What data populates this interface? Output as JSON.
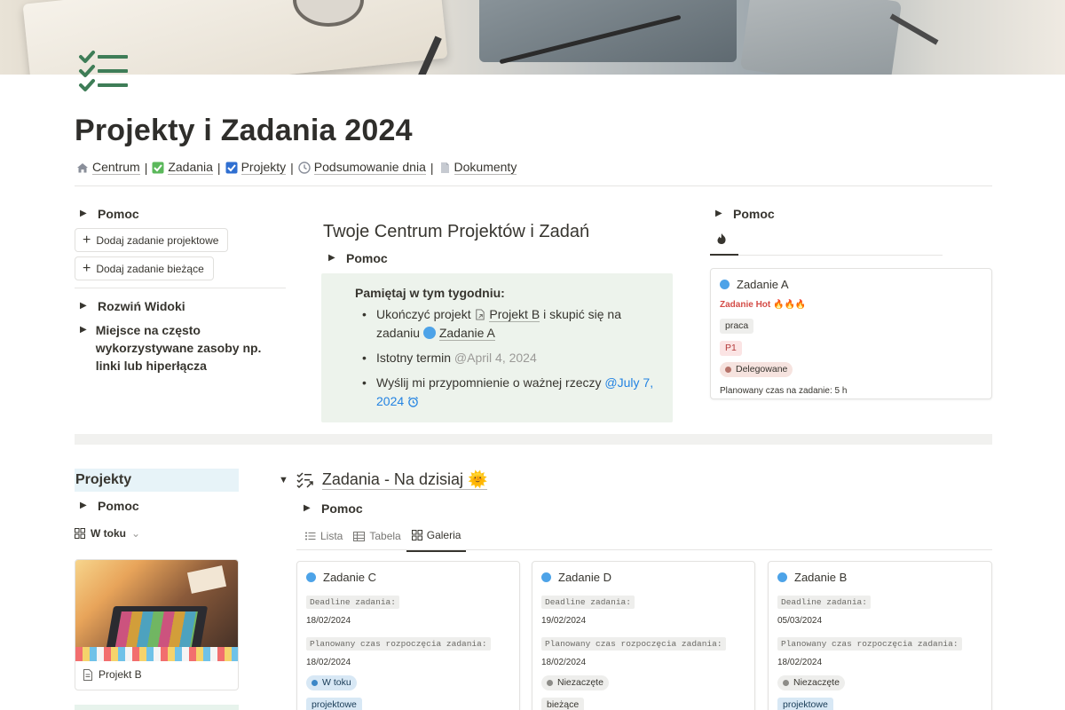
{
  "page": {
    "title": "Projekty i Zadania 2024",
    "icon": "checklist-icon"
  },
  "breadcrumbs": [
    {
      "label": "Centrum",
      "icon": "house-icon"
    },
    {
      "label": "Zadania",
      "icon": "checkbox-green-icon"
    },
    {
      "label": "Projekty",
      "icon": "checkbox-blue-icon"
    },
    {
      "label": "Podsumowanie dnia",
      "icon": "clock-icon"
    },
    {
      "label": "Dokumenty",
      "icon": "document-icon"
    }
  ],
  "left_panel": {
    "help_toggle": "Pomoc",
    "add_project_task": "Dodaj zadanie projektowe",
    "add_current_task": "Dodaj zadanie bieżące",
    "expand_views": "Rozwiń Widoki",
    "resources": "Miejsce na często wykorzystywane zasoby np. linki lub hiperłącza"
  },
  "center_panel": {
    "title": "Twoje Centrum Projektów i Zadań",
    "help_toggle": "Pomoc",
    "callout": {
      "heading": "Pamiętaj w tym tygodniu:",
      "item1_pre": "Ukończyć projekt",
      "item1_link1": "Projekt B",
      "item1_mid": "i skupić się na zadaniu",
      "item1_link2": "Zadanie A",
      "item2_text": "Istotny termin",
      "item2_date": "@April 4, 2024",
      "item3_text": "Wyślij mi przypomnienie o ważnej rzeczy",
      "item3_date": "@July 7, 2024"
    }
  },
  "right_panel": {
    "help_toggle": "Pomoc",
    "tab_icon": "fire-icon",
    "card": {
      "title": "Zadanie A",
      "hot_label": "Zadanie Hot 🔥🔥🔥",
      "tag": "praca",
      "priority": "P1",
      "status": "Delegowane",
      "planned_time": "Planowany czas na zadanie: 5 h"
    }
  },
  "projects_section": {
    "heading": "Projekty",
    "help_toggle": "Pomoc",
    "view_label": "W toku",
    "cards": [
      {
        "name": "Projekt B"
      }
    ]
  },
  "tasks_section": {
    "title": "Zadania - Na dzisiaj 🌞",
    "help_toggle": "Pomoc",
    "tabs": [
      {
        "label": "Lista",
        "active": false
      },
      {
        "label": "Tabela",
        "active": false
      },
      {
        "label": "Galeria",
        "active": true
      }
    ],
    "deadline_label": "Deadline zadania:",
    "start_label": "Planowany czas rozpoczęcia zadania:",
    "cards": [
      {
        "title": "Zadanie C",
        "deadline": "18/02/2024",
        "start": "18/02/2024",
        "status": "W toku",
        "type": "projektowe"
      },
      {
        "title": "Zadanie D",
        "deadline": "19/02/2024",
        "start": "18/02/2024",
        "status": "Niezaczęte",
        "type": "bieżące"
      },
      {
        "title": "Zadanie B",
        "deadline": "05/03/2024",
        "start": "18/02/2024",
        "status": "Niezaczęte",
        "type": "projektowe"
      }
    ]
  },
  "colors": {
    "accent_green": "#3e7d57",
    "callout_bg": "#edf3ec",
    "task_dot": "#4da3e8",
    "mention_blue": "#2383e2",
    "hot_red": "#d44c47"
  }
}
